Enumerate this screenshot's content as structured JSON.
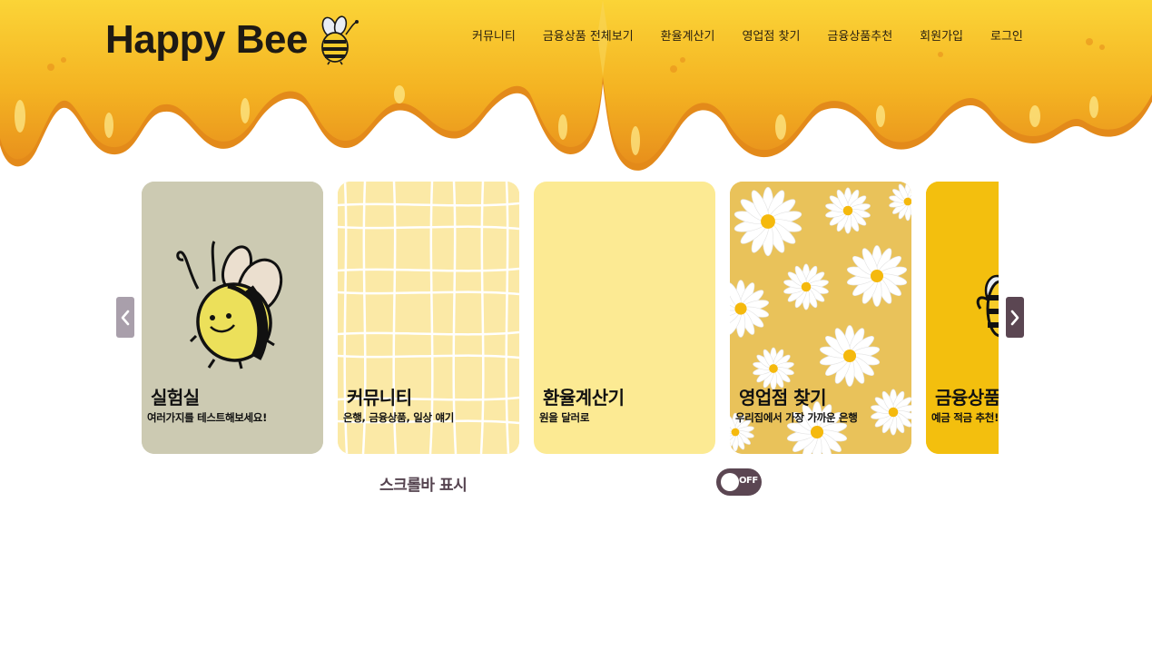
{
  "header": {
    "logo_text": "Happy Bee",
    "nav": [
      {
        "label": "커뮤니티"
      },
      {
        "label": "금융상품 전체보기"
      },
      {
        "label": "환율계산기"
      },
      {
        "label": "영업점 찾기"
      },
      {
        "label": "금융상품추천"
      },
      {
        "label": "회원가입"
      },
      {
        "label": "로그인"
      }
    ]
  },
  "cards": [
    {
      "title": "실험실",
      "subtitle": "여러가지를 테스트해보세요!",
      "bg": "#cccab2",
      "icon": "bee-illustration"
    },
    {
      "title": "커뮤니티",
      "subtitle": "은행, 금융상품, 일상 얘기",
      "bg": "#fbe9a6",
      "icon": "grid-pattern"
    },
    {
      "title": "환율계산기",
      "subtitle": "원을 달러로",
      "bg": "#fcea93",
      "icon": ""
    },
    {
      "title": "영업점 찾기",
      "subtitle": "우리집에서 가장 가까운 은행",
      "bg": "#e9c25a",
      "icon": "daisy-pattern"
    },
    {
      "title": "금융상품 추천",
      "subtitle": "예금 적금 추천!",
      "bg": "#f3bf0e",
      "icon": "bee-icon"
    }
  ],
  "controls": {
    "prev_icon": "chevron-left-icon",
    "next_icon": "chevron-right-icon",
    "scrollbar_label": "스크롤바 표시",
    "toggle_text": "OFF"
  },
  "colors": {
    "honey": "#f6b91f",
    "accent": "#5b4652",
    "accent_light": "#a99fab"
  }
}
